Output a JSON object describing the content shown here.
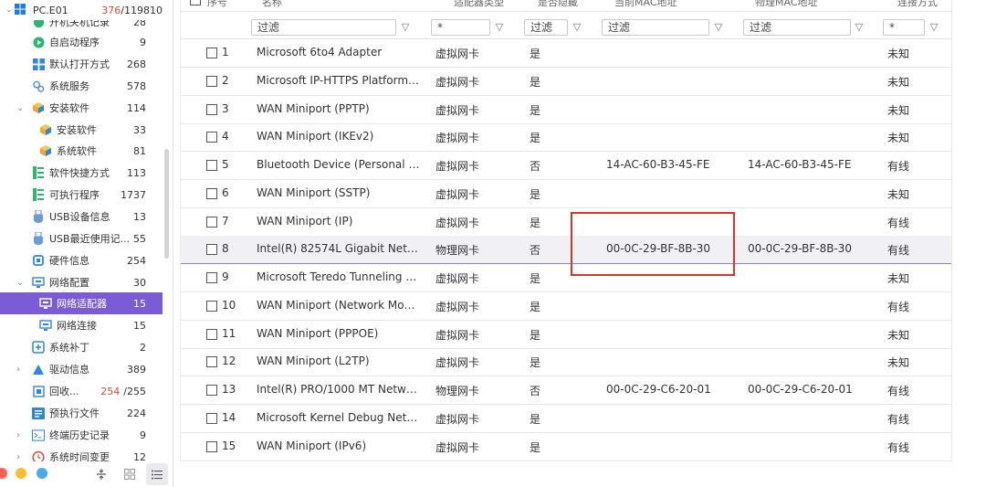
{
  "sidebar": {
    "root": {
      "label": "PC.E01",
      "count_main": "376",
      "count_total": "/119810"
    },
    "clipped_top": {
      "label": "开机关机记录",
      "count": "28"
    },
    "items": [
      {
        "label": "自启动程序",
        "count": "9",
        "icon": "play-icon",
        "color": "#2bb673"
      },
      {
        "label": "默认打开方式",
        "count": "268",
        "icon": "apps-icon",
        "color": "#2d86e0"
      },
      {
        "label": "系统服务",
        "count": "578",
        "icon": "gears-icon",
        "color": "#5a8fd8"
      },
      {
        "label": "安装软件",
        "count": "114",
        "icon": "box-icon",
        "color": "#f2a531"
      },
      {
        "label": "安装软件",
        "count": "33",
        "icon": "box-icon",
        "color": "#f2a531"
      },
      {
        "label": "系统软件",
        "count": "81",
        "icon": "box-icon",
        "color": "#f2a531"
      },
      {
        "label": "软件快捷方式",
        "count": "113",
        "icon": "shortcut-icon",
        "color": "#2bb673"
      },
      {
        "label": "可执行程序",
        "count": "1737",
        "icon": "exe-icon",
        "color": "#2bb673"
      },
      {
        "label": "USB设备信息",
        "count": "13",
        "icon": "usb-icon",
        "color": "#6a9be0"
      },
      {
        "label": "USB最近使用记...",
        "count": "55",
        "icon": "usb-icon",
        "color": "#6a9be0"
      },
      {
        "label": "硬件信息",
        "count": "254",
        "icon": "chip-icon",
        "color": "#2d86e0"
      },
      {
        "label": "网络配置",
        "count": "30",
        "icon": "network-icon",
        "color": "#2d86e0"
      },
      {
        "label": "网络适配器",
        "count": "15",
        "icon": "adapter-icon",
        "color": "#ffffff"
      },
      {
        "label": "网络连接",
        "count": "15",
        "icon": "adapter-icon",
        "color": "#2d86e0"
      },
      {
        "label": "系统补丁",
        "count": "2",
        "icon": "patch-icon",
        "color": "#2d86e0"
      },
      {
        "label": "驱动信息",
        "count": "389",
        "icon": "driver-icon",
        "color": "#2d86e0"
      },
      {
        "label": "回收...",
        "count_main": "254",
        "count_total": "/255",
        "icon": "recycle-icon",
        "color": "#2d86e0"
      },
      {
        "label": "预执行文件",
        "count": "224",
        "icon": "prefetch-icon",
        "color": "#2d86e0"
      },
      {
        "label": "终端历史记录",
        "count": "9",
        "icon": "terminal-icon",
        "color": "#2d86e0"
      },
      {
        "label": "系统时间变更",
        "count": "12",
        "icon": "clock-icon",
        "color": "#e1483b"
      }
    ],
    "dots": [
      "#ff5f57",
      "#febc2e",
      "#4aa8f0"
    ]
  },
  "table": {
    "headers": {
      "no": "序号",
      "name": "名称",
      "type": "适配器类型",
      "hidden": "是否隐藏",
      "mac": "当前MAC地址",
      "pmac": "物理MAC地址",
      "conn": "连接方式"
    },
    "filters": {
      "name": "过滤",
      "type": "*",
      "hidden": "过滤",
      "mac": "过滤",
      "pmac": "过滤",
      "conn": "*"
    },
    "rows": [
      {
        "no": "1",
        "name": "Microsoft 6to4 Adapter",
        "type": "虚拟网卡",
        "hidden": "是",
        "mac": "",
        "pmac": "",
        "conn": "未知"
      },
      {
        "no": "2",
        "name": "Microsoft IP-HTTPS Platform A...",
        "type": "虚拟网卡",
        "hidden": "是",
        "mac": "",
        "pmac": "",
        "conn": "未知"
      },
      {
        "no": "3",
        "name": "WAN Miniport (PPTP)",
        "type": "虚拟网卡",
        "hidden": "是",
        "mac": "",
        "pmac": "",
        "conn": "未知"
      },
      {
        "no": "4",
        "name": "WAN Miniport (IKEv2)",
        "type": "虚拟网卡",
        "hidden": "是",
        "mac": "",
        "pmac": "",
        "conn": "未知"
      },
      {
        "no": "5",
        "name": "Bluetooth Device (Personal Are...",
        "type": "虚拟网卡",
        "hidden": "否",
        "mac": "14-AC-60-B3-45-FE",
        "pmac": "14-AC-60-B3-45-FE",
        "conn": "有线"
      },
      {
        "no": "6",
        "name": "WAN Miniport (SSTP)",
        "type": "虚拟网卡",
        "hidden": "是",
        "mac": "",
        "pmac": "",
        "conn": "未知"
      },
      {
        "no": "7",
        "name": "WAN Miniport (IP)",
        "type": "虚拟网卡",
        "hidden": "是",
        "mac": "",
        "pmac": "",
        "conn": "有线"
      },
      {
        "no": "8",
        "name": "Intel(R) 82574L Gigabit Networ...",
        "type": "物理网卡",
        "hidden": "否",
        "mac": "00-0C-29-BF-8B-30",
        "pmac": "00-0C-29-BF-8B-30",
        "conn": "有线"
      },
      {
        "no": "9",
        "name": "Microsoft Teredo Tunneling Ad...",
        "type": "虚拟网卡",
        "hidden": "是",
        "mac": "",
        "pmac": "",
        "conn": "未知"
      },
      {
        "no": "10",
        "name": "WAN Miniport (Network Monit...",
        "type": "虚拟网卡",
        "hidden": "是",
        "mac": "",
        "pmac": "",
        "conn": "有线"
      },
      {
        "no": "11",
        "name": "WAN Miniport (PPPOE)",
        "type": "虚拟网卡",
        "hidden": "是",
        "mac": "",
        "pmac": "",
        "conn": "未知"
      },
      {
        "no": "12",
        "name": "WAN Miniport (L2TP)",
        "type": "虚拟网卡",
        "hidden": "是",
        "mac": "",
        "pmac": "",
        "conn": "未知"
      },
      {
        "no": "13",
        "name": "Intel(R) PRO/1000 MT Network ...",
        "type": "物理网卡",
        "hidden": "否",
        "mac": "00-0C-29-C6-20-01",
        "pmac": "00-0C-29-C6-20-01",
        "conn": "有线"
      },
      {
        "no": "14",
        "name": "Microsoft Kernel Debug Netwo...",
        "type": "虚拟网卡",
        "hidden": "是",
        "mac": "",
        "pmac": "",
        "conn": "有线"
      },
      {
        "no": "15",
        "name": "WAN Miniport (IPv6)",
        "type": "虚拟网卡",
        "hidden": "是",
        "mac": "",
        "pmac": "",
        "conn": "有线"
      }
    ],
    "highlight_color": "#e0342b",
    "selected_row_color": "#7b5cd6"
  }
}
